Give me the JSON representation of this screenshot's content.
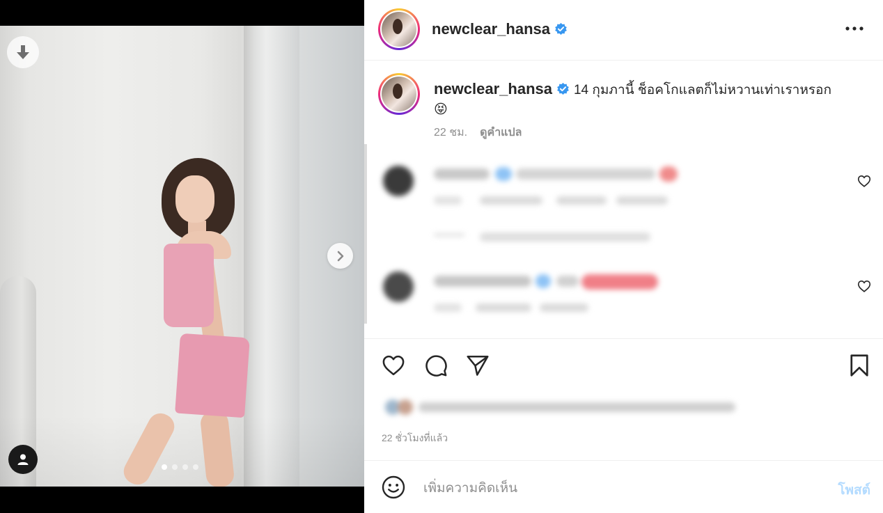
{
  "post": {
    "username": "newclear_hansa",
    "verified": true,
    "caption": "14 กุมภานี้ ช็อคโกแลตก็ไม่หวานเท่าเราหรอก",
    "caption_emoji": "😝",
    "age_short": "22 ชม.",
    "translate_label": "ดูคำแปล",
    "time_ago": "22 ชั่วโมงที่แล้ว",
    "comment_placeholder": "เพิ่มความคิดเห็น",
    "post_label": "โพสต์"
  },
  "media": {
    "slide_count": 4,
    "active_slide": 1
  },
  "icons": {
    "download": "arrow-down-icon",
    "next": "chevron-right-icon",
    "tags": "user-icon",
    "more": "more-horizontal-icon",
    "like": "heart-icon",
    "comment": "comment-icon",
    "share": "paper-plane-icon",
    "save": "bookmark-icon",
    "emoji": "smiley-icon"
  },
  "colors": {
    "verified": "#3897f0",
    "post_button_disabled": "#b3dbff",
    "muted_text": "#8e8e8e"
  }
}
